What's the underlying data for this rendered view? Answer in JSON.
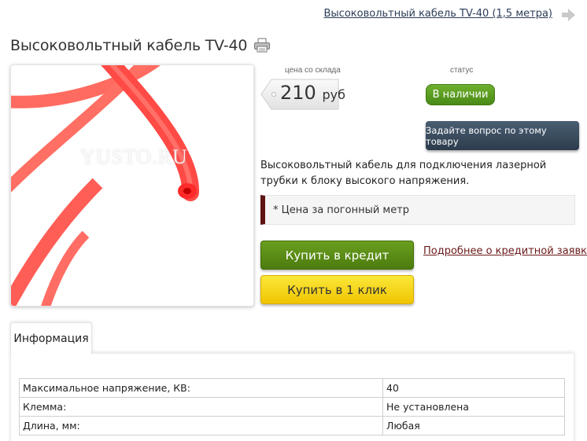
{
  "header": {
    "next_product_link": "Высоковольтный кабель TV-40 (1,5 метра)",
    "title": "Высоковольтный кабель TV-40"
  },
  "photo": {
    "watermark": "YUSTO.RU"
  },
  "price": {
    "caption": "цена со склада",
    "amount": "210",
    "currency": "руб"
  },
  "status": {
    "caption": "статус",
    "value": "В наличии"
  },
  "ask_button": "Задайте вопрос по этому товару",
  "description": "Высоковольтный кабель для подключения лазерной трубки к блоку высокого напряжения.",
  "note": "* Цена за погонный метр",
  "buy": {
    "credit_button": "Купить в кредит",
    "credit_link": "Подробнее о кредитной заявке",
    "one_click_button": "Купить в 1 клик"
  },
  "tabs": [
    {
      "label": "Информация"
    }
  ],
  "specs": [
    {
      "name": "Максимальное напряжение, КВ:",
      "value": "40"
    },
    {
      "name": "Клемма:",
      "value": "Не установлена"
    },
    {
      "name": "Длина, мм:",
      "value": "Любая"
    }
  ],
  "colors": {
    "in_stock": "#5a9c22",
    "credit": "#5c8c17",
    "one_click": "#f6d619",
    "ask": "#34475a",
    "note_accent": "#5e1414",
    "cable": "#ff3b3b"
  },
  "icons": {
    "print": "printer-icon",
    "next": "arrow-right-icon"
  }
}
